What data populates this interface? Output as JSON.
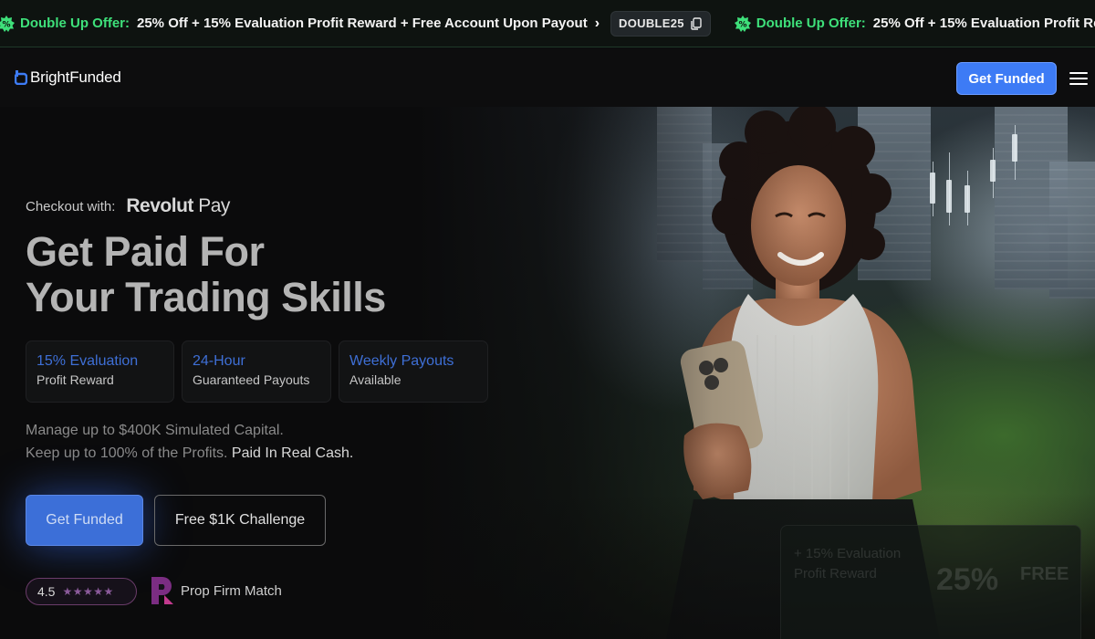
{
  "promo": {
    "title": "Double Up Offer:",
    "text": "25% Off + 15% Evaluation Profit Reward + Free Account Upon Payout",
    "arrow": "›",
    "code": "DOUBLE25",
    "badge_icon": "gift-badge-icon",
    "accent_color": "#3ee07a"
  },
  "header": {
    "brand": "BrightFunded",
    "cta": "Get Funded",
    "menu_icon": "hamburger-icon"
  },
  "hero": {
    "checkout_label": "Checkout with:",
    "checkout_brand_a": "Revolut",
    "checkout_brand_b": " Pay",
    "headline_line1": "Get Paid For",
    "headline_line2": "Your Trading Skills",
    "features": [
      {
        "title": "15% Evaluation",
        "subtitle": "Profit Reward"
      },
      {
        "title": "24-Hour",
        "subtitle": "Guaranteed Payouts"
      },
      {
        "title": "Weekly Payouts",
        "subtitle": "Available"
      }
    ],
    "desc_line1": "Manage up to $400K Simulated Capital.",
    "desc_line2_a": "Keep up to 100% of the Profits. ",
    "desc_line2_b": "Paid In Real Cash.",
    "primary_cta": "Get Funded",
    "secondary_cta": "Free $1K Challenge",
    "rating_value": "4.5",
    "rating_stars": "★★★★★",
    "partner": "Prop Firm Match",
    "ghost_card": {
      "line1": "+ 15% Evaluation",
      "line2": "Profit Reward",
      "badge": "25%",
      "free": "FREE"
    }
  },
  "colors": {
    "primary_blue": "#3d7bf5",
    "feature_title": "#3e6fd6"
  }
}
